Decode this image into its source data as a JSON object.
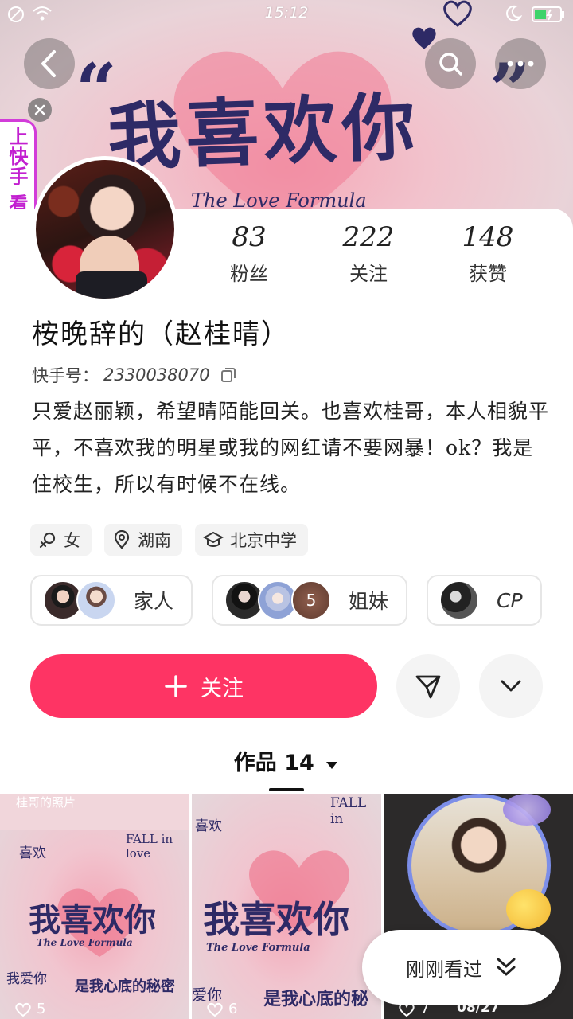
{
  "status_bar": {
    "time": "15:12"
  },
  "banner": {
    "main_text": "我喜欢你",
    "sub_text": "The Love Formula"
  },
  "side_tab": {
    "label": "上快手 看亚运"
  },
  "stats": [
    {
      "value": "83",
      "label": "粉丝"
    },
    {
      "value": "222",
      "label": "关注"
    },
    {
      "value": "148",
      "label": "获赞"
    }
  ],
  "profile": {
    "nickname": "桉晚辞的（赵桂晴）",
    "kuaishou_id_label": "快手号：",
    "kuaishou_id": "2330038070",
    "bio": "只爱赵丽颖，希望晴陌能回关。也喜欢桂哥，本人相貌平平，不喜欢我的明星或我的网红请不要网暴！ok？我是住校生，所以有时候不在线。"
  },
  "tags": [
    {
      "icon": "female-icon",
      "label": "女"
    },
    {
      "icon": "location-icon",
      "label": "湖南"
    },
    {
      "icon": "school-icon",
      "label": "北京中学"
    }
  ],
  "groups": [
    {
      "label": "家人"
    },
    {
      "label": "姐妹",
      "badge": "5"
    },
    {
      "label": "CP"
    }
  ],
  "actions": {
    "follow_label": "关注"
  },
  "works_tab": {
    "label": "作品 14"
  },
  "grid": {
    "cell1": {
      "top_text": "桂哥的照片",
      "side_text": "喜欢",
      "fall_text": "FALL in love",
      "main_text": "我喜欢你",
      "sub_text": "The Love Formula",
      "bottom_text": "是我心底的秘密",
      "corner_text": "我爱你",
      "likes": "5"
    },
    "cell2": {
      "side_text": "喜欢",
      "fall_text": "FALL in",
      "main_text": "我喜欢你",
      "sub_text": "The Love Formula",
      "bottom_text": "是我心底的秘",
      "corner_text": "爱你",
      "likes": "6"
    },
    "cell3": {
      "likes": "7",
      "date": "08/27"
    }
  },
  "recent_pill": {
    "label": "刚刚看过"
  }
}
